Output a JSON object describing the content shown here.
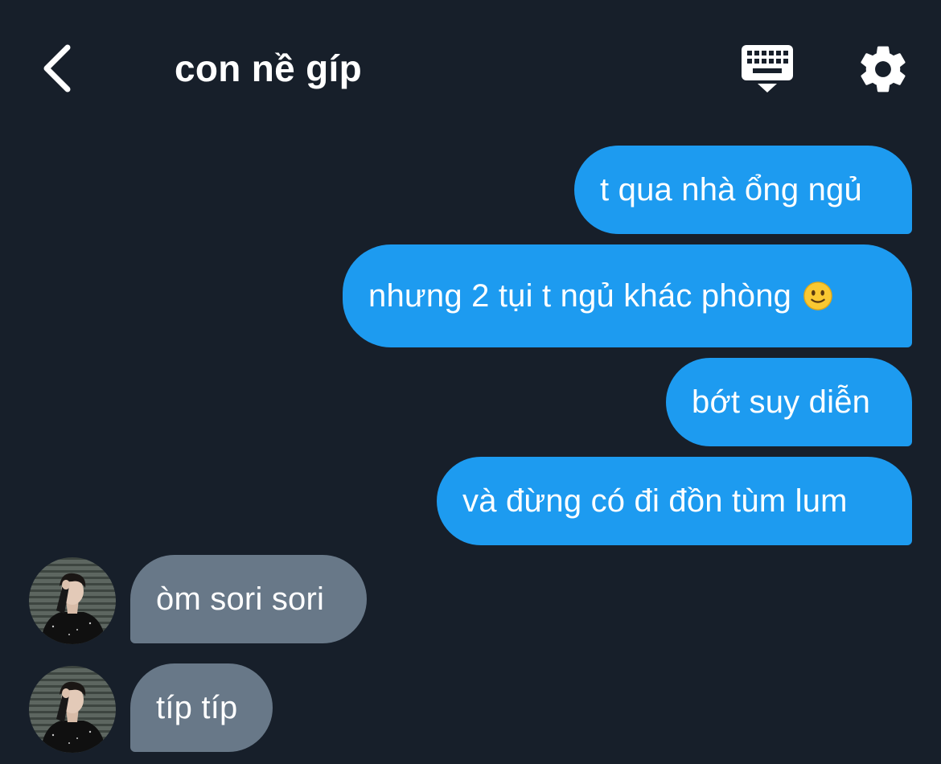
{
  "header": {
    "title": "con nề gíp",
    "back_icon": "chevron-left-icon",
    "keyboard_icon": "keyboard-hide-icon",
    "settings_icon": "gear-icon"
  },
  "colors": {
    "background": "#171f2a",
    "outgoing_bubble": "#1d9bf0",
    "incoming_bubble": "#687888",
    "text": "#ffffff"
  },
  "messages": [
    {
      "direction": "out",
      "text": "t qua nhà ổng ngủ"
    },
    {
      "direction": "out",
      "text": "nhưng 2 tụi t ngủ khác phòng",
      "emoji": "slightly-smiling-face"
    },
    {
      "direction": "out",
      "text": "bớt suy diễn"
    },
    {
      "direction": "out",
      "text": "và đừng có đi đồn tùm lum"
    },
    {
      "direction": "in",
      "text": "òm sori sori",
      "avatar": "contact-avatar"
    },
    {
      "direction": "in",
      "text": "típ típ",
      "avatar": "contact-avatar"
    }
  ]
}
